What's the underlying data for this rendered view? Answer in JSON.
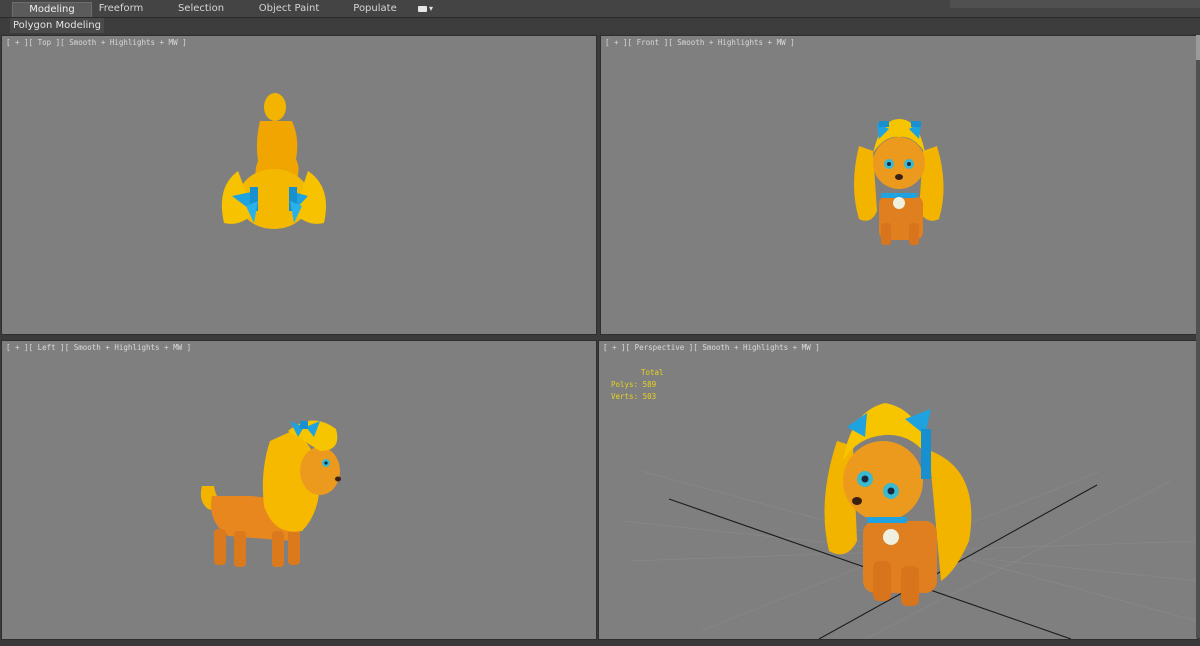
{
  "tabs": [
    {
      "label": "Modeling",
      "active": true
    },
    {
      "label": "Freeform",
      "active": false
    },
    {
      "label": "Selection",
      "active": false
    },
    {
      "label": "Object Paint",
      "active": false
    },
    {
      "label": "Populate",
      "active": false
    }
  ],
  "ribbon_menu_icon": "camera-icon",
  "subpanel": {
    "label": "Polygon Modeling"
  },
  "viewports": {
    "top": {
      "label": "[ + ][ Top ][ Smooth + Highlights + MW ]"
    },
    "front": {
      "label": "[ + ][ Front ][ Smooth + Highlights + MW ]"
    },
    "left": {
      "label": "[ + ][ Left ][ Smooth + Highlights + MW ]"
    },
    "perspective": {
      "label": "[ + ][ Perspective ][ Smooth + Highlights + MW ]"
    }
  },
  "stats": {
    "header": "Total",
    "polys": "Polys: 589",
    "verts": "Verts: 503"
  },
  "colors": {
    "viewport_bg": "#7f7f7f",
    "stats_text": "#e8d21c",
    "model_fur": "#f3b400",
    "model_body": "#e8871e",
    "bow": "#1fa3e0"
  }
}
